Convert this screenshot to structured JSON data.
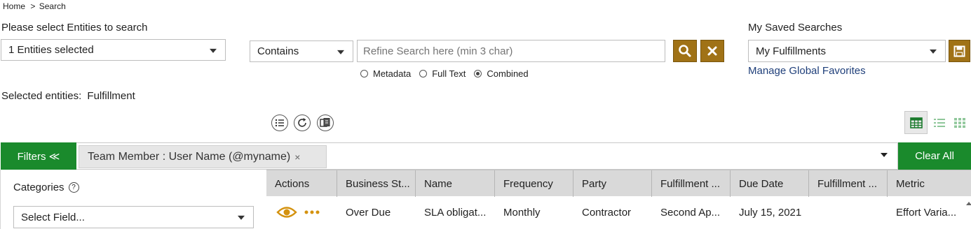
{
  "breadcrumb": {
    "home": "Home",
    "sep": ">",
    "current": "Search"
  },
  "entities": {
    "label": "Please select Entities to search",
    "value": "1 Entities selected"
  },
  "search": {
    "operator": "Contains",
    "placeholder": "Refine Search here (min 3 char)",
    "options": [
      {
        "label": "Metadata",
        "selected": false
      },
      {
        "label": "Full Text",
        "selected": false
      },
      {
        "label": "Combined",
        "selected": true
      }
    ]
  },
  "saved": {
    "label": "My Saved Searches",
    "value": "My Fulfillments",
    "manage_link": "Manage Global Favorites"
  },
  "selected_entities": {
    "label": "Selected entities:",
    "value": "Fulfillment"
  },
  "filters": {
    "button": "Filters ≪",
    "chip": "Team Member : User Name (@myname)",
    "chip_remove": "×",
    "clear_all": "Clear All"
  },
  "categories": {
    "label": "Categories",
    "help": "?",
    "select_placeholder": "Select Field..."
  },
  "table": {
    "columns": [
      "Actions",
      "Business St...",
      "Name",
      "Frequency",
      "Party",
      "Fulfillment ...",
      "Due Date",
      "Fulfillment ...",
      "Metric"
    ],
    "rows": [
      {
        "status": "Over Due",
        "name": "SLA obligat...",
        "frequency": "Monthly",
        "party": "Contractor",
        "fulfillment": "Second Ap...",
        "due_date": "July 15, 2021",
        "fulfillment2": "",
        "metric": "Effort Varia..."
      }
    ]
  },
  "colors": {
    "gold": "#a07216",
    "green": "#1a8a2c",
    "link": "#1f3f7a",
    "header_bg": "#d9d9d9",
    "eye": "#d4920f"
  }
}
